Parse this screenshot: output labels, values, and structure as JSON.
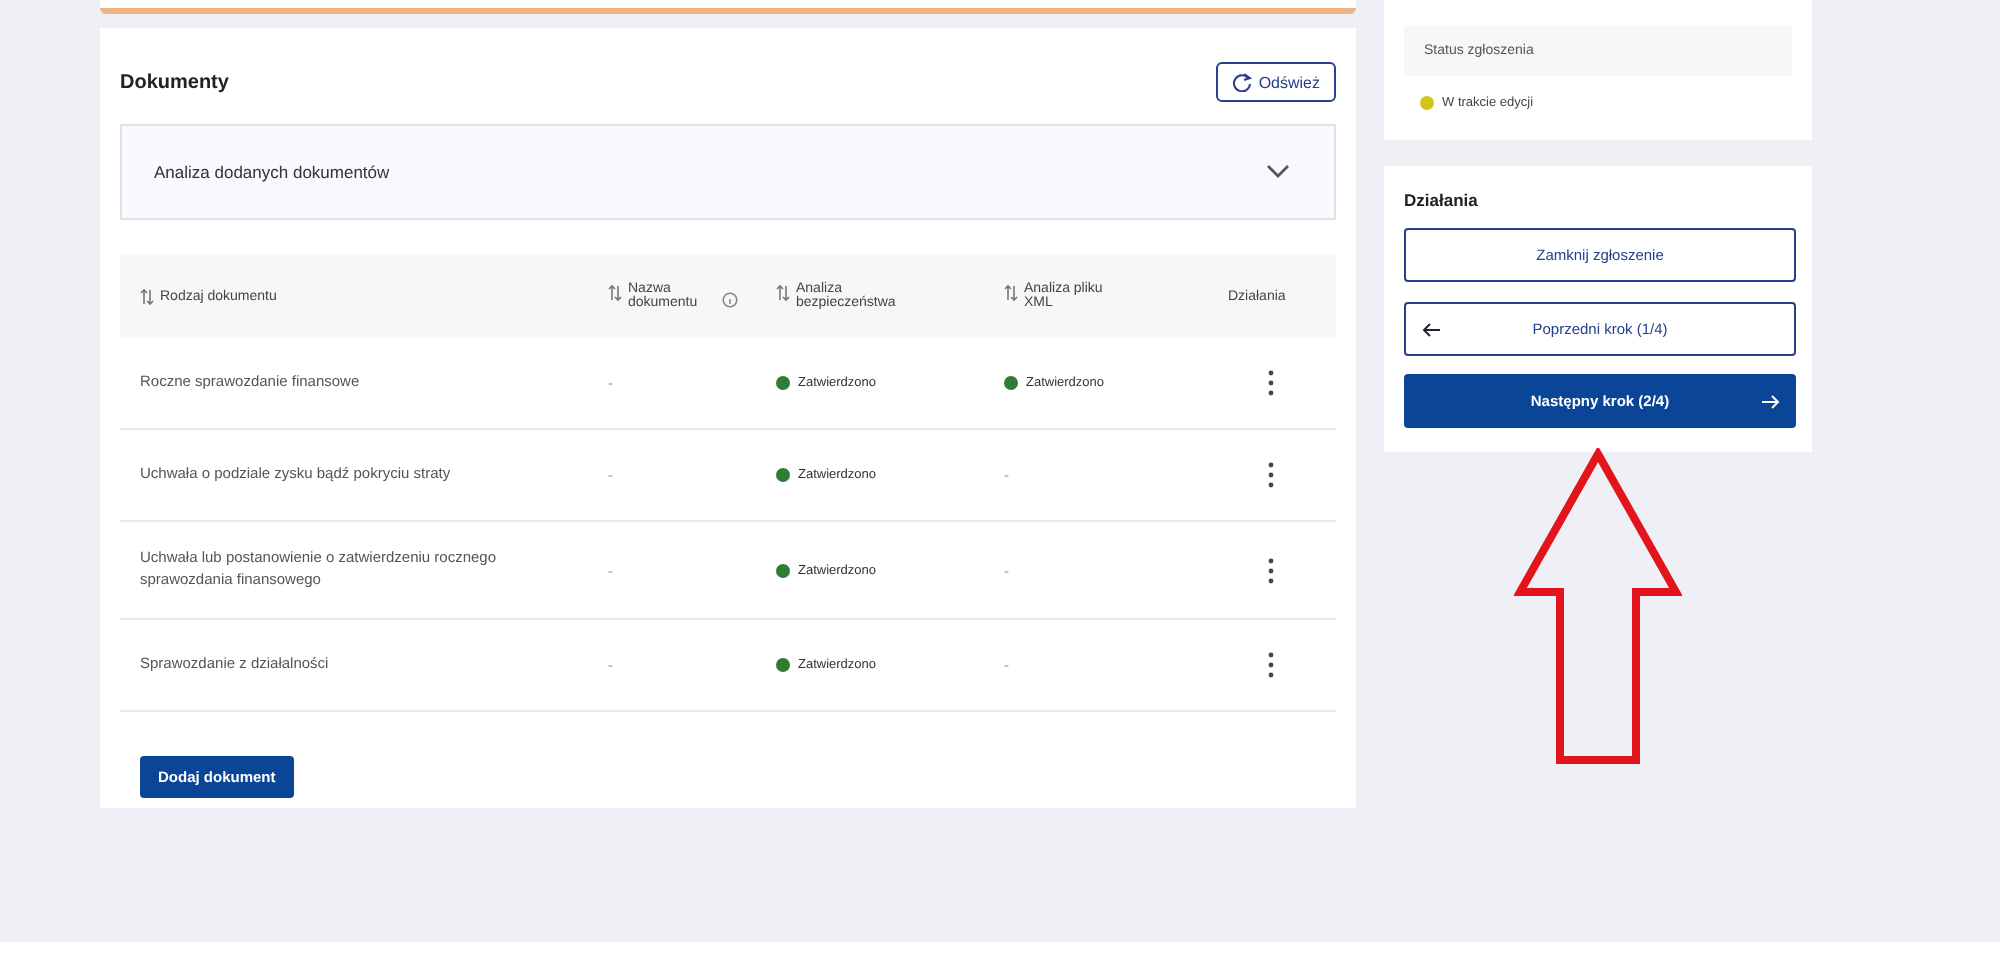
{
  "documents": {
    "title": "Dokumenty",
    "refresh_button": "Odśwież",
    "accordion": {
      "label": "Analiza dodanych dokumentów",
      "expanded": false
    },
    "table": {
      "columns": [
        {
          "label": "Rodzaj dokumentu",
          "sortable": true
        },
        {
          "label": "Nazwa dokumentu",
          "sortable": true,
          "info": true
        },
        {
          "label": "Analiza bezpieczeństwa",
          "sortable": true
        },
        {
          "label": "Analiza pliku XML",
          "sortable": true
        },
        {
          "label": "Działania",
          "sortable": false
        }
      ],
      "rows": [
        {
          "type": "Roczne sprawozdanie finansowe",
          "name": "-",
          "security": {
            "text": "Zatwierdzono",
            "color": "#2e7d32"
          },
          "xml": {
            "text": "Zatwierdzono",
            "color": "#2e7d32"
          }
        },
        {
          "type": "Uchwała o podziale zysku bądź pokryciu straty",
          "name": "-",
          "security": {
            "text": "Zatwierdzono",
            "color": "#2e7d32"
          },
          "xml": {
            "text": "-"
          }
        },
        {
          "type": "Uchwała lub postanowienie o zatwierdzeniu rocznego sprawozdania finansowego",
          "name": "-",
          "security": {
            "text": "Zatwierdzono",
            "color": "#2e7d32"
          },
          "xml": {
            "text": "-"
          }
        },
        {
          "type": "Sprawozdanie z działalności",
          "name": "-",
          "security": {
            "text": "Zatwierdzono",
            "color": "#2e7d32"
          },
          "xml": {
            "text": "-"
          }
        }
      ]
    },
    "add_button": "Dodaj dokument"
  },
  "status": {
    "label": "Status zgłoszenia",
    "value": "W trakcie edycji",
    "color": "#d4c41a"
  },
  "actions": {
    "title": "Działania",
    "buttons": [
      {
        "label": "Zamknij zgłoszenie",
        "kind": "outline"
      },
      {
        "label": "Poprzedni krok (1/4)",
        "kind": "back"
      },
      {
        "label": "Następny krok (2/4)",
        "kind": "next"
      }
    ]
  }
}
